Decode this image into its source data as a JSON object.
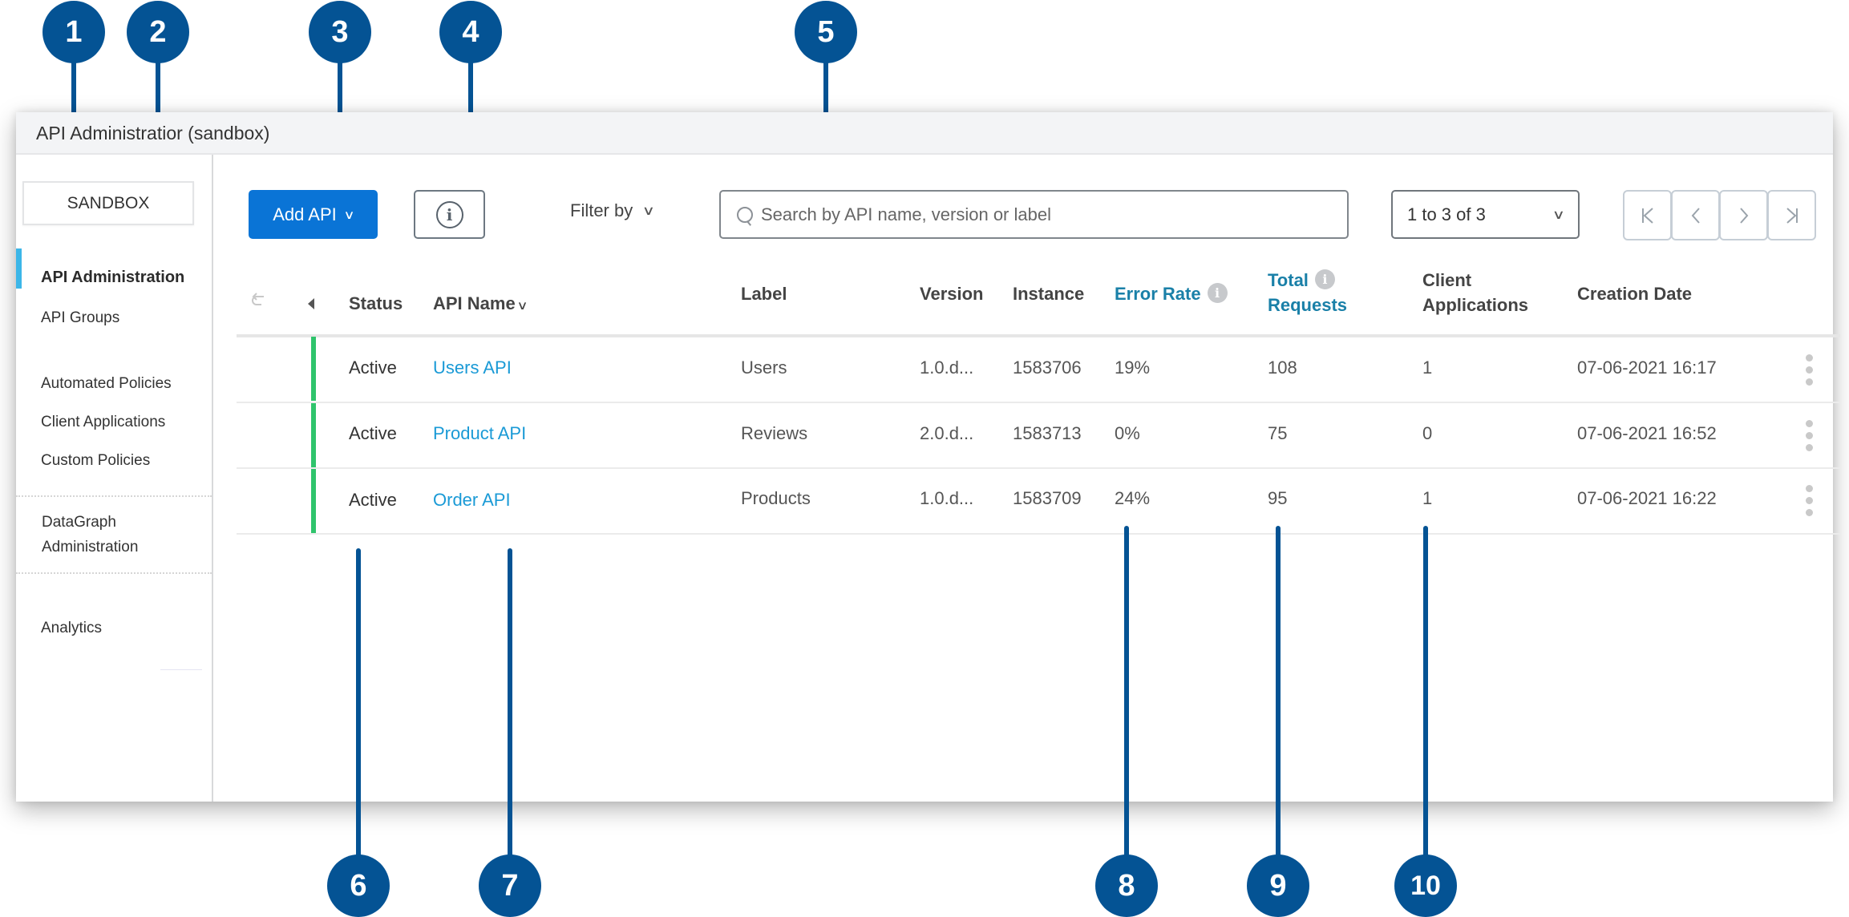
{
  "window": {
    "title": "API Administratior (sandbox)"
  },
  "sidebar": {
    "environment": "SANDBOX",
    "items": [
      {
        "label": "API Administration",
        "active": true
      },
      {
        "label": "API Groups"
      },
      {
        "label": "Automated Policies"
      },
      {
        "label": "Client Applications"
      },
      {
        "label": "Custom Policies"
      },
      {
        "label": "DataGraph Administration"
      },
      {
        "label": "Analytics"
      }
    ]
  },
  "toolbar": {
    "add_api_label": "Add API",
    "info_icon": "i",
    "filter_label": "Filter by",
    "search_placeholder": "Search by API name, version or label",
    "search_value": "",
    "pager_label": "1 to 3 of 3",
    "pager_buttons": {
      "first": "K",
      "prev": "‹",
      "next": "›",
      "last": "›|"
    }
  },
  "table": {
    "columns": {
      "status": "Status",
      "api_name": "API Name",
      "label": "Label",
      "version": "Version",
      "instance": "Instance",
      "error_rate": "Error Rate",
      "total_requests_1": "Total",
      "total_requests_2": "Requests",
      "client_apps_1": "Client",
      "client_apps_2": "Applications",
      "creation_date": "Creation Date"
    },
    "rows": [
      {
        "status": "Active",
        "api_name": "Users API",
        "label": "Users",
        "version": "1.0.d...",
        "instance": "1583706",
        "error_rate": "19%",
        "total_requests": "108",
        "client_apps": "1",
        "creation_date": "07-06-2021 16:17"
      },
      {
        "status": "Active",
        "api_name": "Product API",
        "label": "Reviews",
        "version": "2.0.d...",
        "instance": "1583713",
        "error_rate": "0%",
        "total_requests": "75",
        "client_apps": "0",
        "creation_date": "07-06-2021 16:52"
      },
      {
        "status": "Active",
        "api_name": "Order API",
        "label": "Products",
        "version": "1.0.d...",
        "instance": "1583709",
        "error_rate": "24%",
        "total_requests": "95",
        "client_apps": "1",
        "creation_date": "07-06-2021 16:22"
      }
    ]
  },
  "colors": {
    "accent": "#0a74d6",
    "callout": "#045394",
    "status_active": "#2fc46c",
    "link": "#1a9ad6",
    "metric_header": "#1a80a8"
  },
  "callouts": [
    "1",
    "2",
    "3",
    "4",
    "5",
    "6",
    "7",
    "8",
    "9",
    "10"
  ]
}
